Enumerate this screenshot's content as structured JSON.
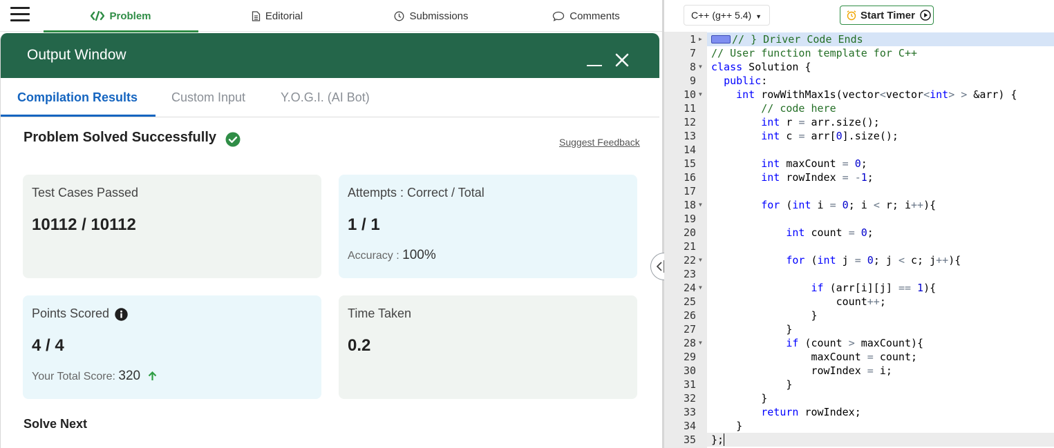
{
  "nav": {
    "tabs": [
      {
        "label": "Problem",
        "icon": "code-icon",
        "active": true
      },
      {
        "label": "Editorial",
        "icon": "document-icon"
      },
      {
        "label": "Submissions",
        "icon": "clock-icon"
      },
      {
        "label": "Comments",
        "icon": "speech-bubble-icon"
      }
    ]
  },
  "output_window": {
    "title": "Output Window",
    "tabs": [
      "Compilation Results",
      "Custom Input",
      "Y.O.G.I. (AI Bot)"
    ],
    "active_tab": "Compilation Results",
    "status": "Problem Solved Successfully",
    "suggest_feedback": "Suggest Feedback",
    "cards": {
      "test_cases": {
        "label": "Test Cases Passed",
        "value": "10112 / 10112"
      },
      "attempts": {
        "label": "Attempts : Correct / Total",
        "value": "1 / 1",
        "sub_label": "Accuracy :",
        "sub_value": "100%"
      },
      "points": {
        "label": "Points Scored",
        "value": "4 / 4",
        "sub_label": "Your Total Score:",
        "sub_value": "320"
      },
      "time": {
        "label": "Time Taken",
        "value": "0.2"
      }
    },
    "solve_next": "Solve Next"
  },
  "editor": {
    "language": "C++ (g++ 5.4)",
    "start_timer": "Start Timer",
    "lines": [
      {
        "n": "1",
        "fold": "right",
        "text": "// } Driver Code Ends"
      },
      {
        "n": "7",
        "text": "// User function template for C++"
      },
      {
        "n": "8",
        "fold": "down",
        "text": "class Solution {"
      },
      {
        "n": "9",
        "text": "  public:"
      },
      {
        "n": "10",
        "fold": "down",
        "text": "    int rowWithMax1s(vector<vector<int> > &arr) {"
      },
      {
        "n": "11",
        "text": "        // code here"
      },
      {
        "n": "12",
        "text": "        int r = arr.size();"
      },
      {
        "n": "13",
        "text": "        int c = arr[0].size();"
      },
      {
        "n": "14",
        "text": ""
      },
      {
        "n": "15",
        "text": "        int maxCount = 0;"
      },
      {
        "n": "16",
        "text": "        int rowIndex = -1;"
      },
      {
        "n": "17",
        "text": ""
      },
      {
        "n": "18",
        "fold": "down",
        "text": "        for (int i = 0; i < r; i++){"
      },
      {
        "n": "19",
        "text": ""
      },
      {
        "n": "20",
        "text": "            int count = 0;"
      },
      {
        "n": "21",
        "text": ""
      },
      {
        "n": "22",
        "fold": "down",
        "text": "            for (int j = 0; j < c; j++){"
      },
      {
        "n": "23",
        "text": ""
      },
      {
        "n": "24",
        "fold": "down",
        "text": "                if (arr[i][j] == 1){"
      },
      {
        "n": "25",
        "text": "                    count++;"
      },
      {
        "n": "26",
        "text": "                }"
      },
      {
        "n": "27",
        "text": "            }"
      },
      {
        "n": "28",
        "fold": "down",
        "text": "            if (count > maxCount){"
      },
      {
        "n": "29",
        "text": "                maxCount = count;"
      },
      {
        "n": "30",
        "text": "                rowIndex = i;"
      },
      {
        "n": "31",
        "text": "            }"
      },
      {
        "n": "32",
        "text": "        }"
      },
      {
        "n": "33",
        "text": "        return rowIndex;"
      },
      {
        "n": "34",
        "text": "    }"
      },
      {
        "n": "35",
        "text": "};"
      }
    ]
  },
  "colors": {
    "brand_green": "#2f8d46",
    "header_green": "#24664a",
    "active_blue": "#1565c0"
  }
}
